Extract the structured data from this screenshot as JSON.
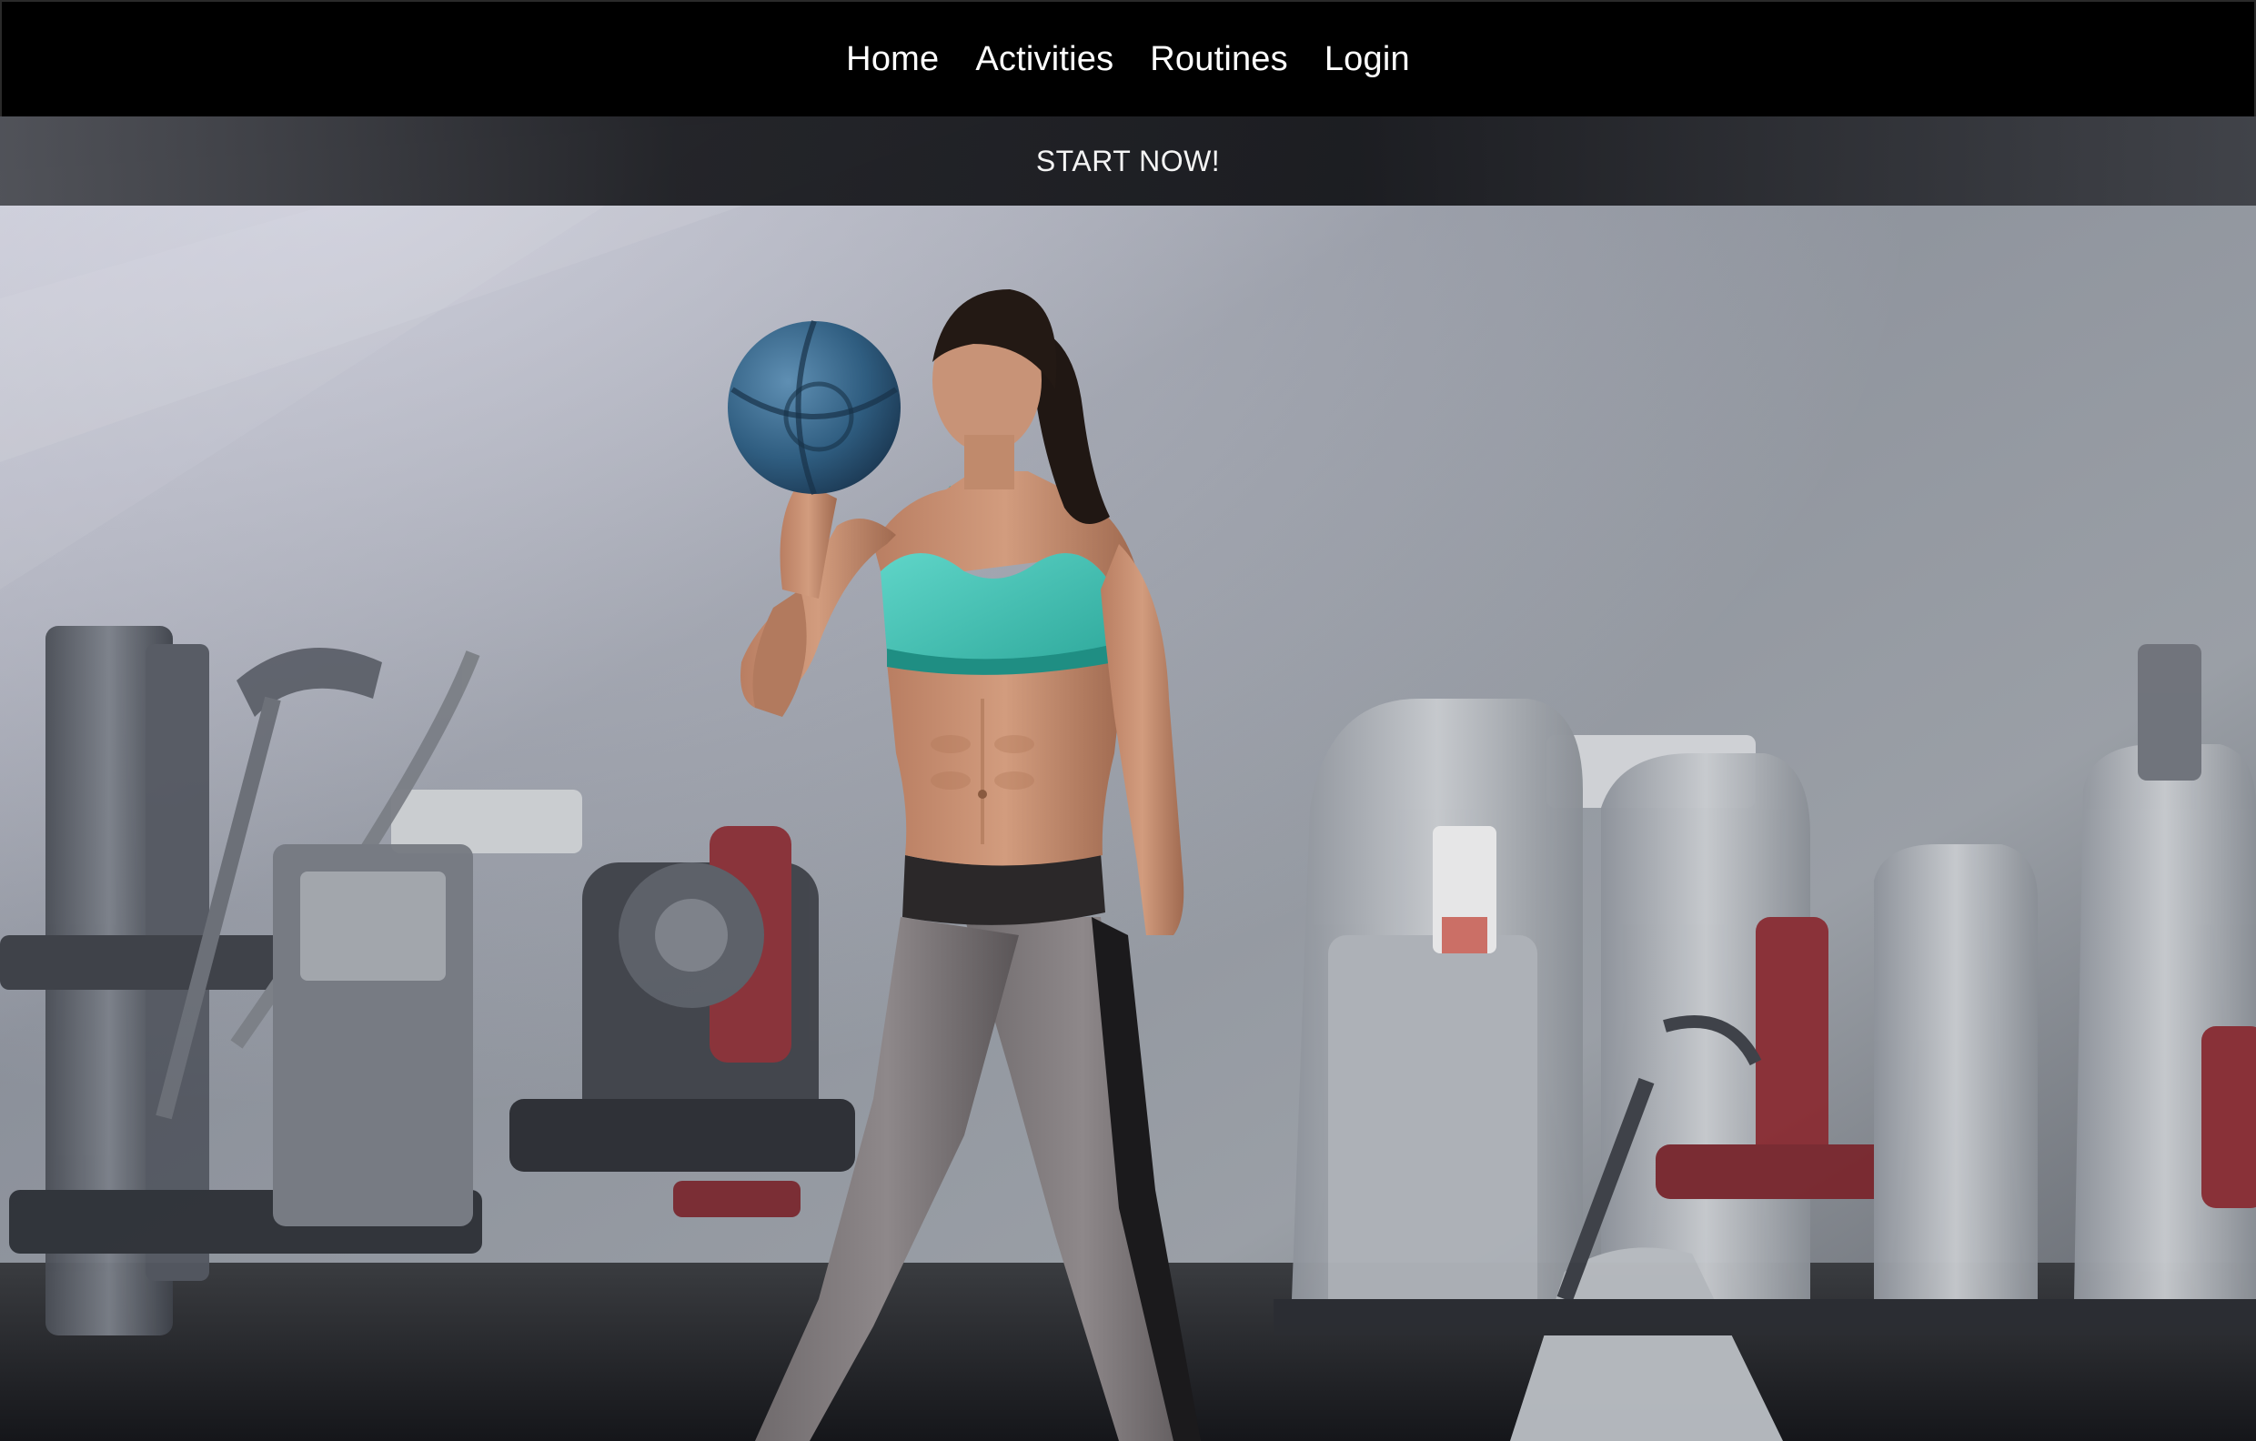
{
  "nav": {
    "items": [
      {
        "label": "Home"
      },
      {
        "label": "Activities"
      },
      {
        "label": "Routines"
      },
      {
        "label": "Login"
      }
    ]
  },
  "hero": {
    "cta_label": "START NOW!",
    "image_icon": "gym-hero-photo"
  },
  "colors": {
    "navbar_bg": "#000000",
    "nav_text": "#ffffff",
    "cta_text": "#f4f4f4",
    "top_accent": "#49c9bd"
  }
}
